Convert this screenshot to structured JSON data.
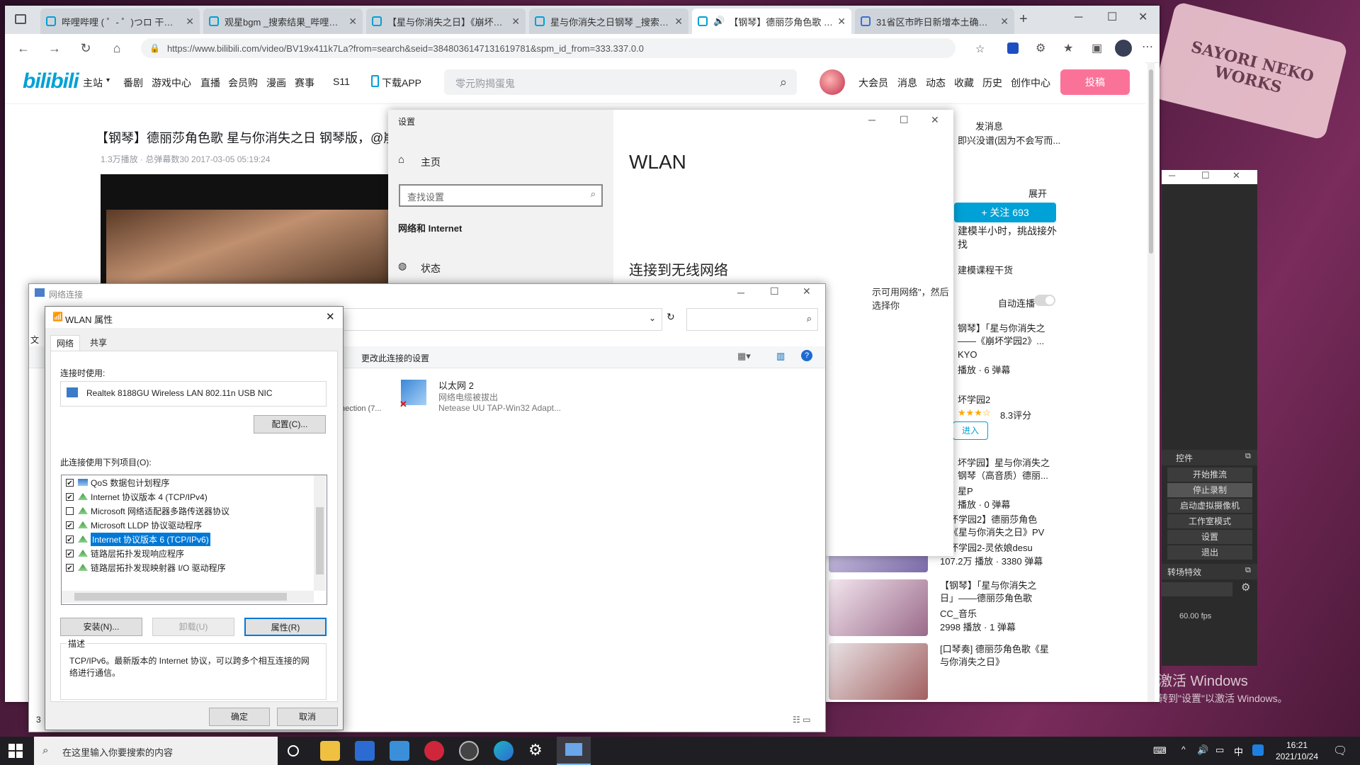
{
  "desktop": {
    "sticker_text": "SAYORI NEKO WORKS",
    "activate_title": "激活 Windows",
    "activate_sub": "转到\"设置\"以激活 Windows。"
  },
  "browser": {
    "tabs": [
      {
        "label": "哔哩哔哩 ( ゜- ゜)つロ 干杯~-bili"
      },
      {
        "label": "观星bgm _搜索结果_哔哩哔哩"
      },
      {
        "label": "【星与你消失之日】《崩坏3》"
      },
      {
        "label": "星与你消失之日钢琴 _搜索结果"
      },
      {
        "label": "【钢琴】德丽莎角色歌 星与"
      },
      {
        "label": "31省区市昨日新增本土确诊26"
      }
    ],
    "url": "https://www.bilibili.com/video/BV19x411k7La?from=search&seid=3848036147131619781&spm_id_from=333.337.0.0"
  },
  "bili": {
    "logo": "bilibili",
    "nav": [
      "主站",
      "番剧",
      "游戏中心",
      "直播",
      "会员购",
      "漫画",
      "赛事",
      "S11",
      "下载APP"
    ],
    "search_placeholder": "零元购揭蛋鬼",
    "right_nav": [
      "大会员",
      "消息",
      "动态",
      "收藏",
      "历史",
      "创作中心"
    ],
    "upload": "投稿",
    "video_title": "【钢琴】德丽莎角色歌 星与你消失之日 钢琴版，@崩",
    "video_meta": "1.3万播放 · 总弹幕数30   2017-03-05 05:19:24",
    "sidebar": {
      "send_msg": "发消息",
      "desc": "即兴没谱(因为不会写而...",
      "follow": "+ 关注 693",
      "expand": "展开",
      "ad_title": "建模半小时，挑战接外",
      "ad_title2": "找",
      "ad_sub": "建模课程干货",
      "autoplay": "自动连播",
      "rec": [
        {
          "title": "钢琴】「星与你消失之",
          "title2": "——《崩坏学园2》...",
          "up": "KYO",
          "stats": "播放 · 6 弹幕"
        },
        {
          "title": "坏学园2",
          "rating": "8.3评分",
          "btn": "进入"
        },
        {
          "title": "坏学园】星与你消失之",
          "title2": "钢琴（高音质）德丽...",
          "up": "星P",
          "stats": "播放 · 0 弹幕"
        },
        {
          "title": "崩坏学园2】德丽莎角色",
          "title2": "歌《星与你消失之日》PV",
          "up": "崩坏学园2-灵依娘desu",
          "stats": "107.2万 播放 · 3380 弹幕"
        },
        {
          "title": "【钢琴】「星与你消失之",
          "title2": "日」——德丽莎角色歌",
          "up": "CC_音乐",
          "stats": "2998 播放 · 1 弹幕"
        },
        {
          "title": "[口琴奏] 德丽莎角色歌《星",
          "title2": "与你消失之日》"
        }
      ]
    }
  },
  "settings": {
    "title": "设置",
    "home": "主页",
    "search_placeholder": "查找设置",
    "category": "网络和 Internet",
    "status": "状态",
    "page_title": "WLAN",
    "section": "连接到无线网络",
    "hint": "示可用网络\"，然后选择你"
  },
  "netconn": {
    "title": "网络连接",
    "toolbar_link": "更改此连接的设置",
    "left_partial": "nection (7...",
    "adapter_name": "以太网 2",
    "adapter_status": "网络电缆被拔出",
    "adapter_device": "Netease UU TAP-Win32 Adapt...",
    "left_menu": "文",
    "left_count": "3"
  },
  "wlan": {
    "title": "WLAN 属性",
    "tabs": [
      "网络",
      "共享"
    ],
    "connect_using": "连接时使用:",
    "adapter": "Realtek 8188GU Wireless LAN 802.11n USB NIC",
    "configure": "配置(C)...",
    "items_label": "此连接使用下列项目(O):",
    "items": [
      {
        "label": "QoS 数据包计划程序",
        "checked": "✔"
      },
      {
        "label": "Internet 协议版本 4 (TCP/IPv4)",
        "checked": "✔"
      },
      {
        "label": "Microsoft 网络适配器多路传送器协议",
        "checked": ""
      },
      {
        "label": "Microsoft LLDP 协议驱动程序",
        "checked": "✔"
      },
      {
        "label": "Internet 协议版本 6 (TCP/IPv6)",
        "checked": "✔"
      },
      {
        "label": "链路层拓扑发现响应程序",
        "checked": "✔"
      },
      {
        "label": "链路层拓扑发现映射器 I/O 驱动程序",
        "checked": "✔"
      }
    ],
    "install": "安装(N)...",
    "uninstall": "卸载(U)",
    "properties": "属性(R)",
    "desc_label": "描述",
    "desc_text": "TCP/IPv6。最新版本的 Internet 协议，可以跨多个相互连接的网络进行通信。",
    "ok": "确定",
    "cancel": "取消"
  },
  "obs": {
    "controls_label": "控件",
    "buttons": [
      "开始推流",
      "停止录制",
      "启动虚拟摄像机",
      "工作室模式",
      "设置",
      "退出"
    ],
    "transition_label": "转场特效",
    "fps": "60.00 fps"
  },
  "taskbar": {
    "search_placeholder": "在这里输入你要搜索的内容",
    "time": "16:21",
    "date": "2021/10/24",
    "ime": "中"
  }
}
